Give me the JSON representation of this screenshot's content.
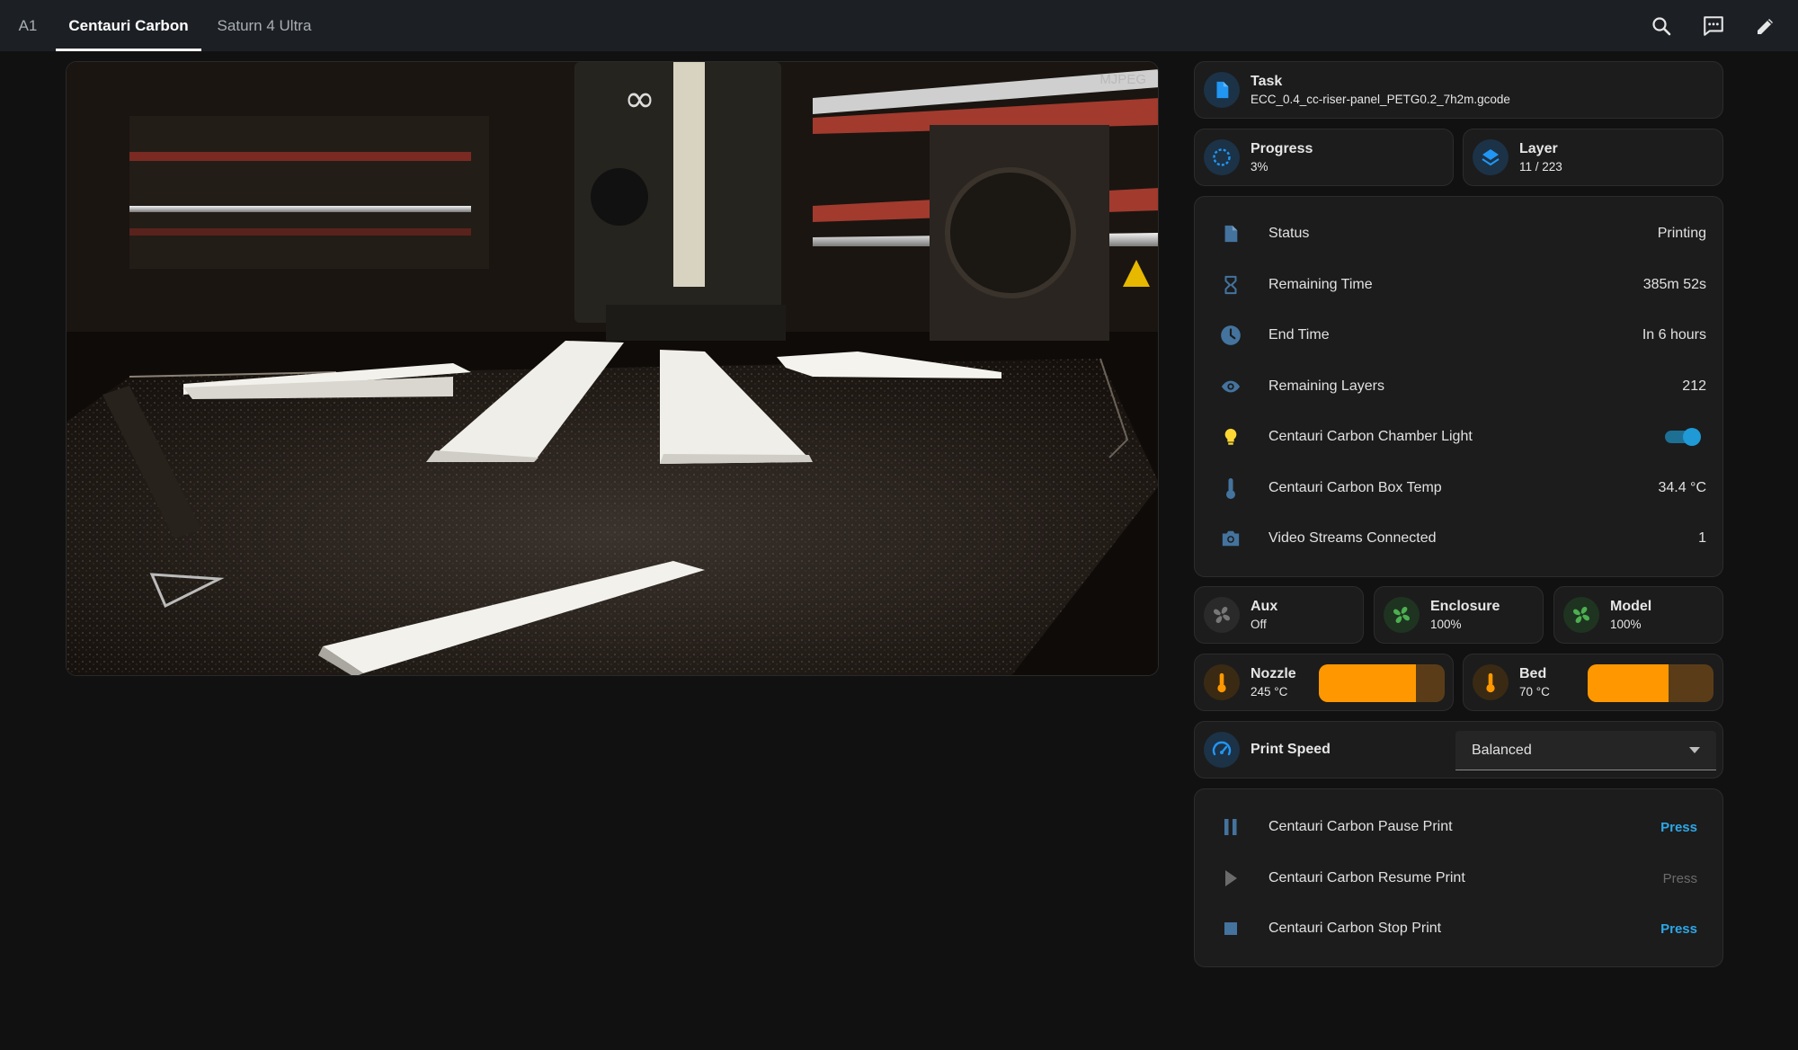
{
  "tabs": [
    {
      "label": "A1"
    },
    {
      "label": "Centauri Carbon",
      "active": true
    },
    {
      "label": "Saturn 4 Ultra"
    }
  ],
  "toolbar": {
    "icons": [
      "search-icon",
      "assist-icon",
      "edit-icon"
    ]
  },
  "camera": {
    "stream_type": "MJPEG"
  },
  "task": {
    "name": "Task",
    "value": "ECC_0.4_cc-riser-panel_PETG0.2_7h2m.gcode"
  },
  "progress": {
    "name": "Progress",
    "value": "3%"
  },
  "layer": {
    "name": "Layer",
    "value": "11 / 223"
  },
  "entities": [
    {
      "icon": "file-icon",
      "name": "Status",
      "value": "Printing"
    },
    {
      "icon": "hourglass-icon",
      "name": "Remaining Time",
      "value": "385m 52s"
    },
    {
      "icon": "clock-icon",
      "name": "End Time",
      "value": "In 6 hours"
    },
    {
      "icon": "eye-icon",
      "name": "Remaining Layers",
      "value": "212"
    },
    {
      "icon": "lightbulb-icon",
      "name": "Centauri Carbon Chamber Light",
      "value": "on"
    },
    {
      "icon": "thermometer-icon",
      "name": "Centauri Carbon Box Temp",
      "value": "34.4 °C"
    },
    {
      "icon": "camera-icon",
      "name": "Video Streams Connected",
      "value": "1"
    }
  ],
  "fans": [
    {
      "name": "Aux",
      "value": "Off"
    },
    {
      "name": "Enclosure",
      "value": "100%"
    },
    {
      "name": "Model",
      "value": "100%"
    }
  ],
  "temps": [
    {
      "name": "Nozzle",
      "value": "245 °C",
      "level": 0.77
    },
    {
      "name": "Bed",
      "value": "70 °C",
      "level": 0.64
    }
  ],
  "print_speed": {
    "name": "Print Speed",
    "selected": "Balanced"
  },
  "actions": [
    {
      "icon": "pause-icon",
      "name": "Centauri Carbon Pause Print",
      "button": "Press",
      "enabled": true
    },
    {
      "icon": "play-icon",
      "name": "Centauri Carbon Resume Print",
      "button": "Press",
      "enabled": false
    },
    {
      "icon": "stop-icon",
      "name": "Centauri Carbon Stop Print",
      "button": "Press",
      "enabled": true
    }
  ],
  "colors": {
    "accent_blue": "#2ea7e8",
    "icon_blue": "#44739e",
    "fan_green": "#4caf50",
    "heat_orange": "#ff9800",
    "light_yellow": "#fdd835"
  }
}
